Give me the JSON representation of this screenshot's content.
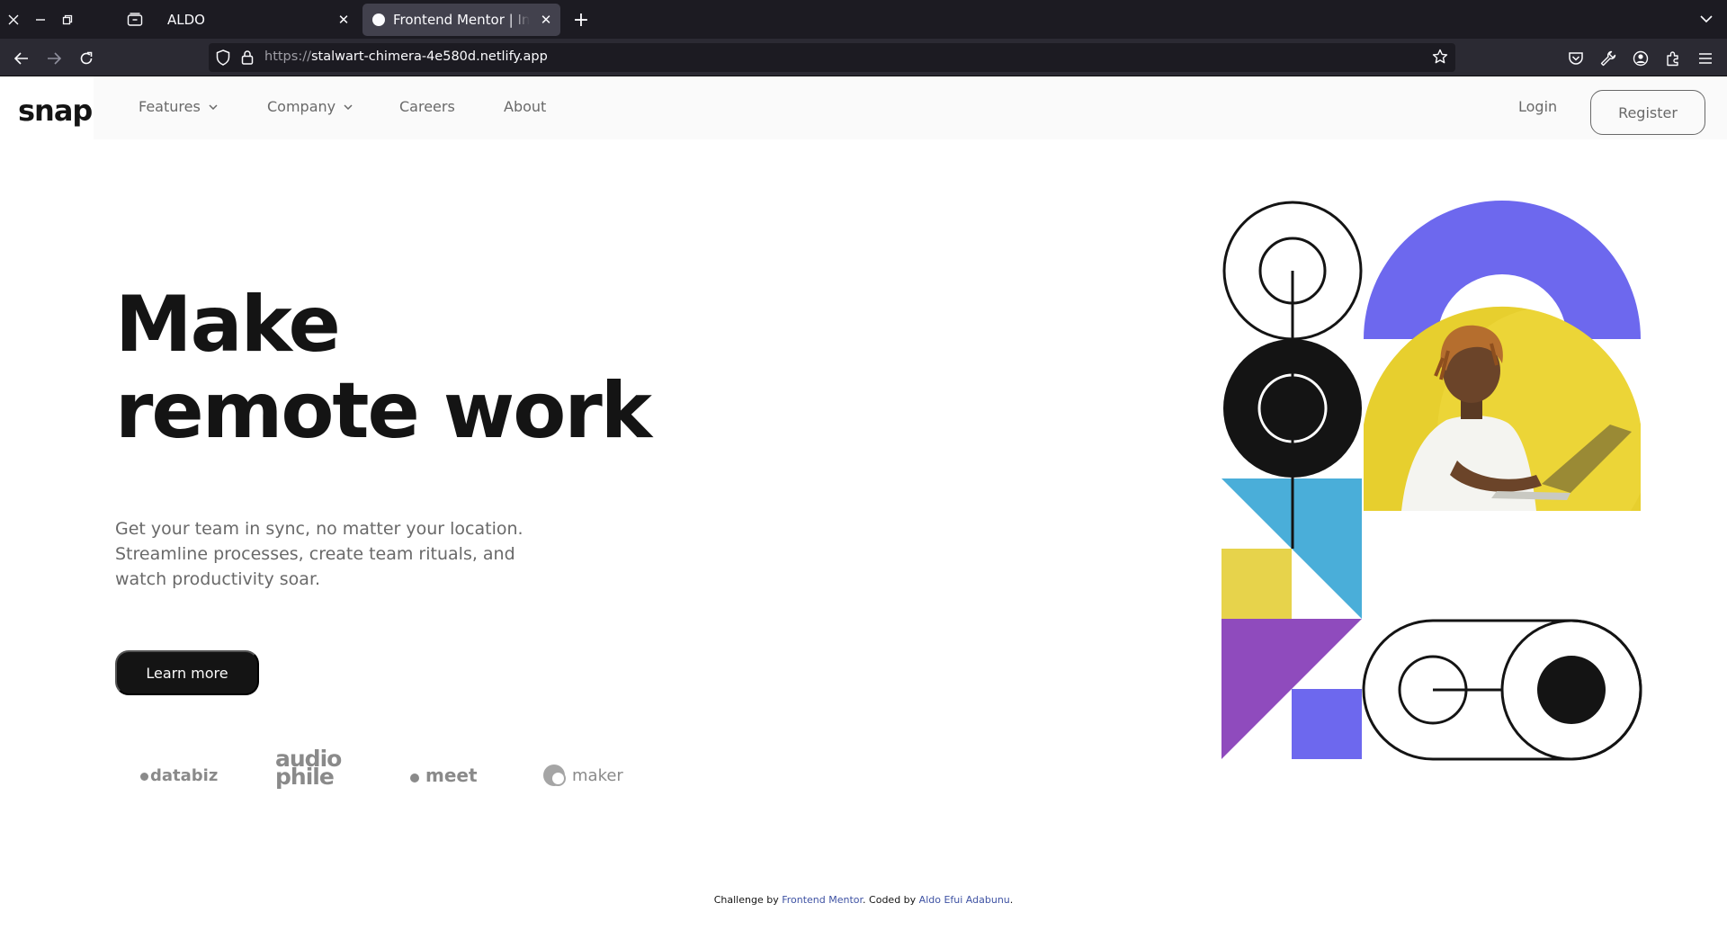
{
  "browser": {
    "tabs": [
      {
        "title": "ALDO",
        "active": false
      },
      {
        "title": "Frontend Mentor | Intro section with dropdown navigation",
        "active": true
      }
    ],
    "url_scheme": "https://",
    "url_host": "stalwart-chimera-4e580d.netlify.app"
  },
  "site": {
    "logo": "snap",
    "nav": {
      "features": "Features",
      "company": "Company",
      "careers": "Careers",
      "about": "About",
      "login": "Login",
      "register": "Register"
    },
    "hero": {
      "title_line1": "Make",
      "title_line2": "remote work",
      "text": "Get your team in sync, no matter your location. Streamline processes, create team rituals, and watch productivity soar.",
      "cta": "Learn more"
    },
    "clients": {
      "databiz": "databiz",
      "audiophile_top": "audio",
      "audiophile_bottom": "phile",
      "meet": "meet",
      "maker": "maker"
    },
    "attribution": {
      "prefix": "Challenge by ",
      "fm": "Frontend Mentor",
      "middle": ". Coded by ",
      "author": "Aldo Efui Adabunu",
      "suffix": "."
    }
  },
  "colors": {
    "accent_purple": "#6d68ee",
    "accent_yellow": "#e7d34b",
    "accent_blue": "#4aaed9",
    "accent_violet": "#8f4bbd",
    "ink": "#141414"
  }
}
